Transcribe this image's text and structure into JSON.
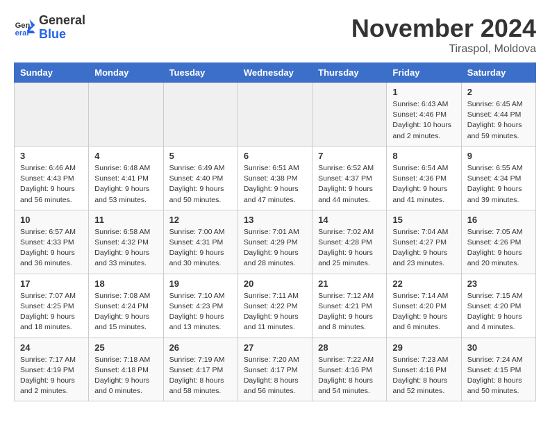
{
  "header": {
    "logo_general": "General",
    "logo_blue": "Blue",
    "title": "November 2024",
    "location": "Tiraspol, Moldova"
  },
  "weekdays": [
    "Sunday",
    "Monday",
    "Tuesday",
    "Wednesday",
    "Thursday",
    "Friday",
    "Saturday"
  ],
  "weeks": [
    [
      {
        "day": "",
        "info": ""
      },
      {
        "day": "",
        "info": ""
      },
      {
        "day": "",
        "info": ""
      },
      {
        "day": "",
        "info": ""
      },
      {
        "day": "",
        "info": ""
      },
      {
        "day": "1",
        "info": "Sunrise: 6:43 AM\nSunset: 4:46 PM\nDaylight: 10 hours\nand 2 minutes."
      },
      {
        "day": "2",
        "info": "Sunrise: 6:45 AM\nSunset: 4:44 PM\nDaylight: 9 hours\nand 59 minutes."
      }
    ],
    [
      {
        "day": "3",
        "info": "Sunrise: 6:46 AM\nSunset: 4:43 PM\nDaylight: 9 hours\nand 56 minutes."
      },
      {
        "day": "4",
        "info": "Sunrise: 6:48 AM\nSunset: 4:41 PM\nDaylight: 9 hours\nand 53 minutes."
      },
      {
        "day": "5",
        "info": "Sunrise: 6:49 AM\nSunset: 4:40 PM\nDaylight: 9 hours\nand 50 minutes."
      },
      {
        "day": "6",
        "info": "Sunrise: 6:51 AM\nSunset: 4:38 PM\nDaylight: 9 hours\nand 47 minutes."
      },
      {
        "day": "7",
        "info": "Sunrise: 6:52 AM\nSunset: 4:37 PM\nDaylight: 9 hours\nand 44 minutes."
      },
      {
        "day": "8",
        "info": "Sunrise: 6:54 AM\nSunset: 4:36 PM\nDaylight: 9 hours\nand 41 minutes."
      },
      {
        "day": "9",
        "info": "Sunrise: 6:55 AM\nSunset: 4:34 PM\nDaylight: 9 hours\nand 39 minutes."
      }
    ],
    [
      {
        "day": "10",
        "info": "Sunrise: 6:57 AM\nSunset: 4:33 PM\nDaylight: 9 hours\nand 36 minutes."
      },
      {
        "day": "11",
        "info": "Sunrise: 6:58 AM\nSunset: 4:32 PM\nDaylight: 9 hours\nand 33 minutes."
      },
      {
        "day": "12",
        "info": "Sunrise: 7:00 AM\nSunset: 4:31 PM\nDaylight: 9 hours\nand 30 minutes."
      },
      {
        "day": "13",
        "info": "Sunrise: 7:01 AM\nSunset: 4:29 PM\nDaylight: 9 hours\nand 28 minutes."
      },
      {
        "day": "14",
        "info": "Sunrise: 7:02 AM\nSunset: 4:28 PM\nDaylight: 9 hours\nand 25 minutes."
      },
      {
        "day": "15",
        "info": "Sunrise: 7:04 AM\nSunset: 4:27 PM\nDaylight: 9 hours\nand 23 minutes."
      },
      {
        "day": "16",
        "info": "Sunrise: 7:05 AM\nSunset: 4:26 PM\nDaylight: 9 hours\nand 20 minutes."
      }
    ],
    [
      {
        "day": "17",
        "info": "Sunrise: 7:07 AM\nSunset: 4:25 PM\nDaylight: 9 hours\nand 18 minutes."
      },
      {
        "day": "18",
        "info": "Sunrise: 7:08 AM\nSunset: 4:24 PM\nDaylight: 9 hours\nand 15 minutes."
      },
      {
        "day": "19",
        "info": "Sunrise: 7:10 AM\nSunset: 4:23 PM\nDaylight: 9 hours\nand 13 minutes."
      },
      {
        "day": "20",
        "info": "Sunrise: 7:11 AM\nSunset: 4:22 PM\nDaylight: 9 hours\nand 11 minutes."
      },
      {
        "day": "21",
        "info": "Sunrise: 7:12 AM\nSunset: 4:21 PM\nDaylight: 9 hours\nand 8 minutes."
      },
      {
        "day": "22",
        "info": "Sunrise: 7:14 AM\nSunset: 4:20 PM\nDaylight: 9 hours\nand 6 minutes."
      },
      {
        "day": "23",
        "info": "Sunrise: 7:15 AM\nSunset: 4:20 PM\nDaylight: 9 hours\nand 4 minutes."
      }
    ],
    [
      {
        "day": "24",
        "info": "Sunrise: 7:17 AM\nSunset: 4:19 PM\nDaylight: 9 hours\nand 2 minutes."
      },
      {
        "day": "25",
        "info": "Sunrise: 7:18 AM\nSunset: 4:18 PM\nDaylight: 9 hours\nand 0 minutes."
      },
      {
        "day": "26",
        "info": "Sunrise: 7:19 AM\nSunset: 4:17 PM\nDaylight: 8 hours\nand 58 minutes."
      },
      {
        "day": "27",
        "info": "Sunrise: 7:20 AM\nSunset: 4:17 PM\nDaylight: 8 hours\nand 56 minutes."
      },
      {
        "day": "28",
        "info": "Sunrise: 7:22 AM\nSunset: 4:16 PM\nDaylight: 8 hours\nand 54 minutes."
      },
      {
        "day": "29",
        "info": "Sunrise: 7:23 AM\nSunset: 4:16 PM\nDaylight: 8 hours\nand 52 minutes."
      },
      {
        "day": "30",
        "info": "Sunrise: 7:24 AM\nSunset: 4:15 PM\nDaylight: 8 hours\nand 50 minutes."
      }
    ]
  ]
}
